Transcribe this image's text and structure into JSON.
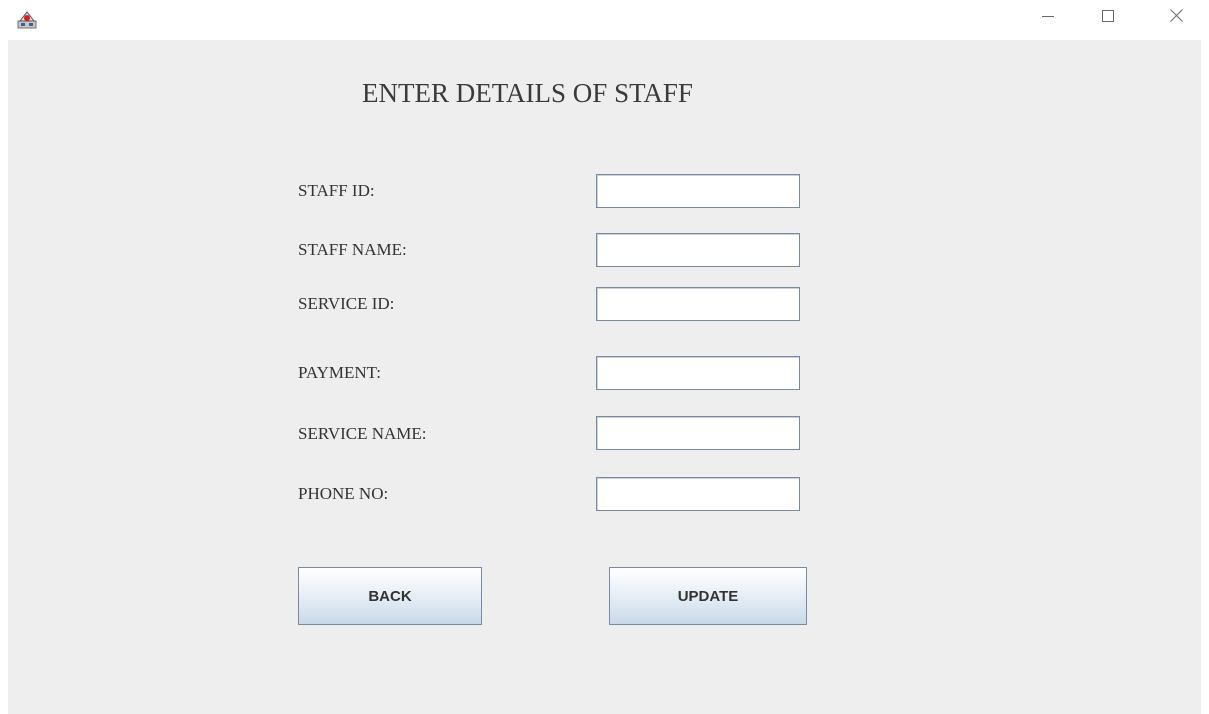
{
  "window": {
    "icons": {
      "app": "java-app-icon",
      "minimize": "minimize-icon",
      "maximize": "maximize-icon",
      "close": "close-icon"
    }
  },
  "form": {
    "title": "ENTER DETAILS OF STAFF",
    "fields": [
      {
        "label": "STAFF ID:",
        "value": ""
      },
      {
        "label": "STAFF NAME:",
        "value": ""
      },
      {
        "label": "SERVICE ID:",
        "value": ""
      },
      {
        "label": "PAYMENT:",
        "value": ""
      },
      {
        "label": "SERVICE NAME:",
        "value": ""
      },
      {
        "label": "PHONE NO:",
        "value": ""
      }
    ],
    "buttons": {
      "back_label": "BACK",
      "update_label": "UPDATE"
    }
  },
  "colors": {
    "panel_background": "#eeeeee",
    "button_border": "#7a8aa0",
    "input_border": "#7a8a9e"
  }
}
